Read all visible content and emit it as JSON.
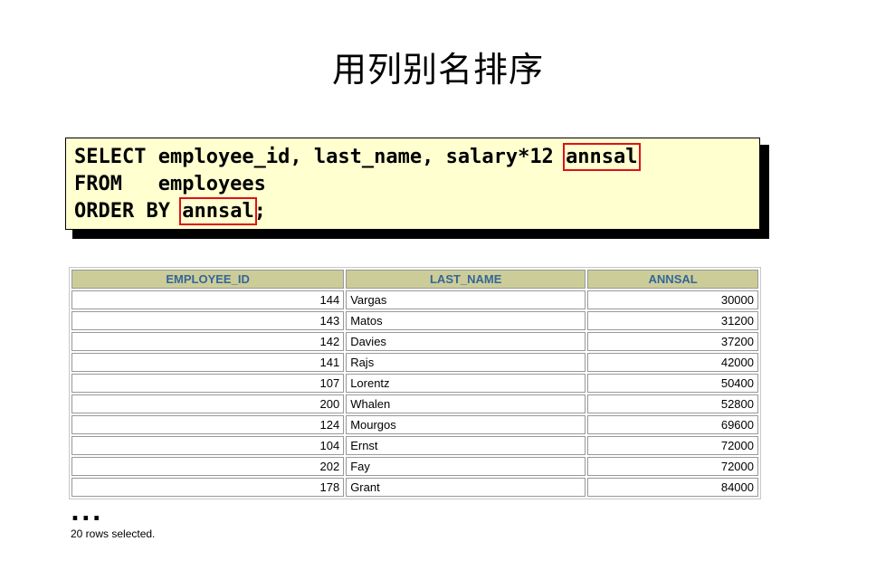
{
  "title": "用列别名排序",
  "sql": {
    "line1_prefix": "SELECT employee_id, last_name, salary*12 ",
    "line1_alias": "annsal",
    "line2": "FROM   employees",
    "line3_prefix": "ORDER BY ",
    "line3_alias": "annsal",
    "line3_suffix": ";"
  },
  "table": {
    "columns": [
      "EMPLOYEE_ID",
      "LAST_NAME",
      "ANNSAL"
    ],
    "rows": [
      [
        "144",
        "Vargas",
        "30000"
      ],
      [
        "143",
        "Matos",
        "31200"
      ],
      [
        "142",
        "Davies",
        "37200"
      ],
      [
        "141",
        "Rajs",
        "42000"
      ],
      [
        "107",
        "Lorentz",
        "50400"
      ],
      [
        "200",
        "Whalen",
        "52800"
      ],
      [
        "124",
        "Mourgos",
        "69600"
      ],
      [
        "104",
        "Ernst",
        "72000"
      ],
      [
        "202",
        "Fay",
        "72000"
      ],
      [
        "178",
        "Grant",
        "84000"
      ]
    ]
  },
  "ellipsis": "...",
  "footer": "20 rows selected.",
  "colors": {
    "header_bg": "#cccc99",
    "header_text": "#336699",
    "code_bg": "#ffffd0",
    "highlight": "#e0101a"
  }
}
